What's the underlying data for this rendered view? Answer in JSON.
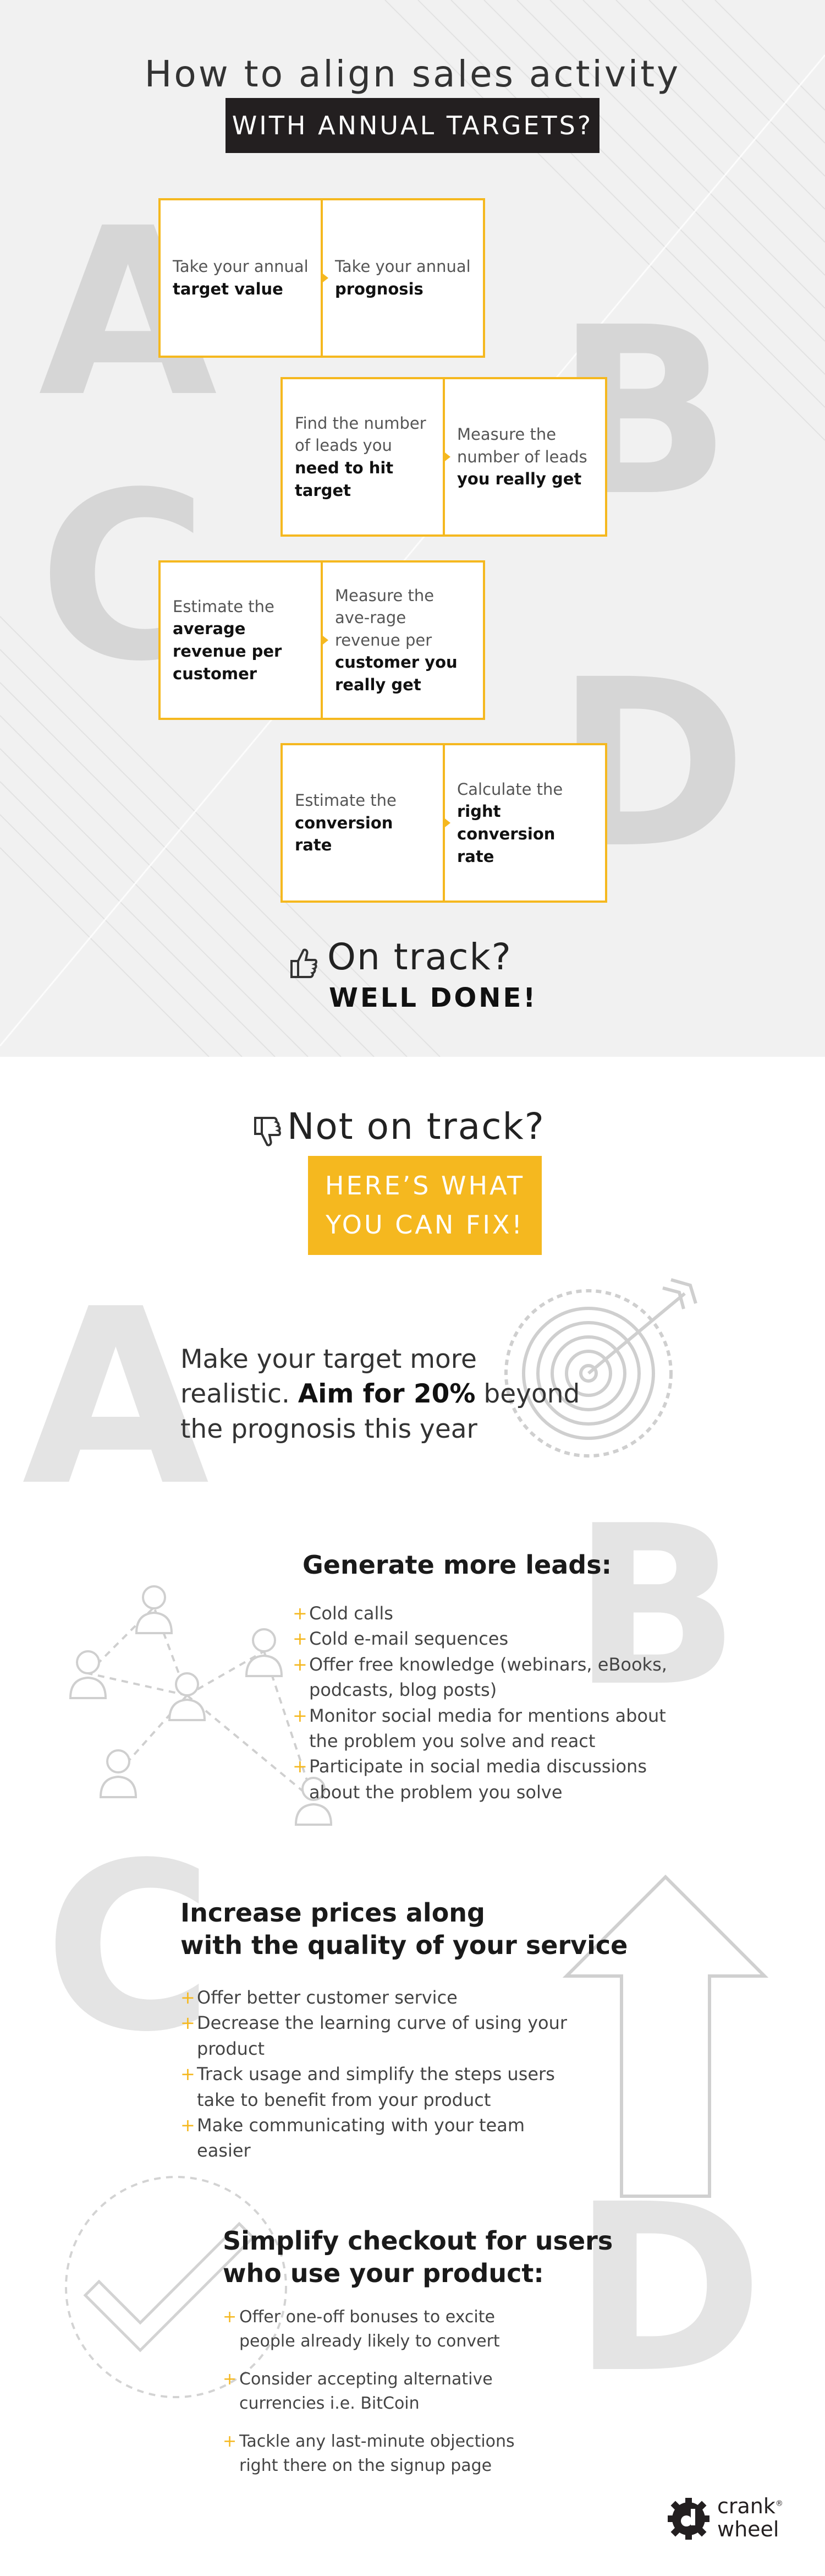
{
  "header": {
    "title": "How to align sales activity",
    "banner": "WITH ANNUAL TARGETS?"
  },
  "letters": {
    "a": "A",
    "b": "B",
    "c": "C",
    "d": "D"
  },
  "steps": [
    {
      "left_pre": "Take your annual",
      "left_bold": "target value",
      "right_pre": "Take your annual",
      "right_bold": "prognosis"
    },
    {
      "left_pre": "Find the number of leads you",
      "left_bold": "need to hit target",
      "right_pre": "Measure the number of leads",
      "right_bold": "you really get"
    },
    {
      "left_pre": "Estimate the",
      "left_bold": "average revenue per customer",
      "right_pre": "Measure the ave-rage revenue per",
      "right_bold": "customer you really get"
    },
    {
      "left_pre": "Estimate the",
      "left_bold": "conversion rate",
      "right_pre": "Calculate the",
      "right_bold": "right conversion rate"
    }
  ],
  "on_track": {
    "title": "On track?",
    "subtitle": "WELL DONE!"
  },
  "not_on_track": {
    "title": "Not on track?",
    "banner_line1": "HERE’S WHAT",
    "banner_line2": "YOU CAN FIX!"
  },
  "section_a": {
    "line1": "Make your target more",
    "line2_pre": "realistic.",
    "line2_bold": "Aim for 20%",
    "line2_post": "beyond",
    "line3": "the prognosis this year"
  },
  "section_b": {
    "heading": "Generate more leads:",
    "items": [
      "Cold calls",
      "Cold e-mail sequences",
      "Offer free knowledge (webinars, eBooks, podcasts, blog posts)",
      "Monitor social media for mentions about the problem you solve and react",
      "Participate in social media discussions about the problem you solve"
    ]
  },
  "section_c": {
    "heading_line1": "Increase prices along",
    "heading_line2": "with the quality of your service",
    "items": [
      "Offer better customer service",
      "Decrease the learning curve of using your product",
      "Track usage and simplify the steps users take to benefit from your product",
      "Make communicating with your team easier"
    ]
  },
  "section_d": {
    "heading_line1": "Simplify checkout for users",
    "heading_line2": "who use your product:",
    "items": [
      "Offer one-off bonuses to excite people already likely to convert",
      "Consider accepting alternative currencies i.e. BitCoin",
      "Tackle any last-minute objections right there on the signup page"
    ]
  },
  "brand": {
    "line1": "crank",
    "line2": "wheel",
    "mark": "®"
  },
  "colors": {
    "accent": "#f5b81f",
    "dark": "#231f20",
    "letter": "#d6d6d6"
  }
}
